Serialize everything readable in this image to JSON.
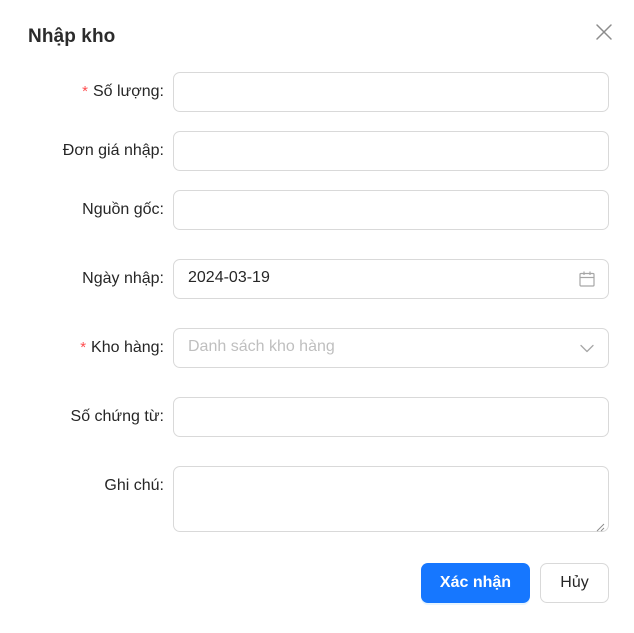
{
  "dialog": {
    "title": "Nhập kho",
    "close_icon": "close-icon"
  },
  "form": {
    "required_mark": "*",
    "quantity": {
      "label": "Số lượng",
      "value": ""
    },
    "import_price": {
      "label": "Đơn giá nhập",
      "value": ""
    },
    "origin": {
      "label": "Nguồn gốc",
      "value": ""
    },
    "import_date": {
      "label": "Ngày nhập",
      "value": "2024-03-19",
      "icon": "calendar-icon"
    },
    "warehouse": {
      "label": "Kho hàng",
      "placeholder": "Danh sách kho hàng",
      "icon": "chevron-down-icon"
    },
    "document_no": {
      "label": "Số chứng từ",
      "value": ""
    },
    "note": {
      "label": "Ghi chú",
      "value": ""
    },
    "label_suffix": ":"
  },
  "footer": {
    "confirm_label": "Xác nhận",
    "cancel_label": "Hủy"
  },
  "colors": {
    "primary": "#1677ff",
    "required": "#ff4d4f",
    "border": "#d9d9d9",
    "placeholder": "#bfbfbf"
  }
}
